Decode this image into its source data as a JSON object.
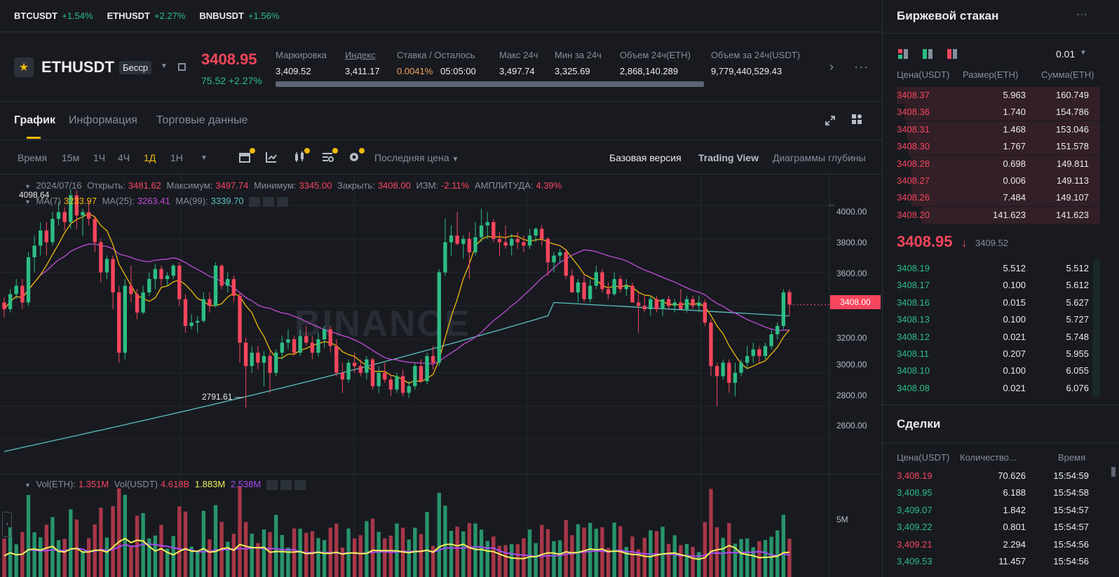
{
  "ticker": [
    {
      "symbol": "BTCUSDT",
      "change": "+1.54%"
    },
    {
      "symbol": "ETHUSDT",
      "change": "+2.27%"
    },
    {
      "symbol": "BNBUSDT",
      "change": "+1.56%"
    }
  ],
  "header": {
    "symbol": "ETHUSDT",
    "contract": "Бесср",
    "last_price": "3408.95",
    "change": "75.52 +2.27%",
    "stats": [
      {
        "label": "Маркировка",
        "value": "3,409.52"
      },
      {
        "label": "Индекс",
        "value": "3,411.17"
      },
      {
        "label": "Ставка / Осталось",
        "value": "0.0041%",
        "value2": "05:05:00"
      },
      {
        "label": "Макс 24ч",
        "value": "3,497.74"
      },
      {
        "label": "Мин за 24ч",
        "value": "3,325.69"
      },
      {
        "label": "Объем 24ч(ETH)",
        "value": "2,868,140.289"
      },
      {
        "label": "Объем за 24ч(USDT)",
        "value": "9,779,440,529.43"
      }
    ]
  },
  "tabs": [
    "График",
    "Информация",
    "Торговые данные"
  ],
  "toolbar": {
    "time_label": "Время",
    "intervals": [
      "15м",
      "1Ч",
      "4Ч",
      "1Д",
      "1Н"
    ],
    "selected_interval": "1Д",
    "price_type": "Последняя цена",
    "views": [
      "Базовая версия",
      "Trading View",
      "Диаграммы глубины"
    ]
  },
  "chart_legend": {
    "date": "2024/07/16",
    "open_label": "Открыть:",
    "open": "3481.62",
    "high_label": "Максимум:",
    "high": "3497.74",
    "low_label": "Минимум:",
    "low": "3345.00",
    "close_label": "Закрыть:",
    "close": "3408.00",
    "chg_label": "ИЗМ:",
    "chg": "-2.11%",
    "amp_label": "АМПЛИТУДА:",
    "amp": "4.39%",
    "ma7_label": "MA(7)",
    "ma7": "3233.97",
    "ma25_label": "MA(25):",
    "ma25": "3263.41",
    "ma99_label": "MA(99):",
    "ma99": "3339.70",
    "vol_eth_label": "Vol(ETH):",
    "vol_eth": "1.351M",
    "vol_usdt_label": "Vol(USDT)",
    "vol_usdt": "4.618B",
    "vol_ma1": "1.883M",
    "vol_ma2": "2.538M"
  },
  "chart_labels": {
    "max_marker": "4098.64",
    "min_marker": "2791.61 —",
    "price_tag": "3408.00",
    "watermark": "BINANCE",
    "yticks": [
      "4000.00",
      "3800.00",
      "3600.00",
      "3400.00",
      "3200.00",
      "3000.00",
      "2800.00",
      "2600.00"
    ],
    "vol_tick": "5M"
  },
  "chart_data": {
    "type": "candlestick",
    "ylim": [
      2400,
      4180
    ],
    "candles": [
      [
        3420,
        3450,
        3330,
        3380
      ],
      [
        3380,
        3500,
        3360,
        3470
      ],
      [
        3470,
        3560,
        3440,
        3520
      ],
      [
        3520,
        3560,
        3380,
        3420
      ],
      [
        3420,
        3720,
        3400,
        3690
      ],
      [
        3690,
        3820,
        3600,
        3760
      ],
      [
        3760,
        3900,
        3700,
        3850
      ],
      [
        3850,
        3900,
        3700,
        3780
      ],
      [
        3780,
        3960,
        3760,
        3920
      ],
      [
        3920,
        4020,
        3880,
        3960
      ],
      [
        3960,
        3990,
        3850,
        3900
      ],
      [
        3900,
        4098,
        3860,
        4060
      ],
      [
        4060,
        4090,
        3860,
        3940
      ],
      [
        3940,
        3980,
        3820,
        3960
      ],
      [
        3960,
        4030,
        3880,
        3920
      ],
      [
        3920,
        3930,
        3720,
        3780
      ],
      [
        3780,
        3800,
        3540,
        3600
      ],
      [
        3600,
        3700,
        3560,
        3680
      ],
      [
        3680,
        3700,
        3380,
        3480
      ],
      [
        3480,
        3520,
        3060,
        3120
      ],
      [
        3120,
        3560,
        3080,
        3520
      ],
      [
        3520,
        3640,
        3420,
        3470
      ],
      [
        3470,
        3500,
        3320,
        3360
      ],
      [
        3360,
        3520,
        3350,
        3480
      ],
      [
        3480,
        3600,
        3460,
        3560
      ],
      [
        3560,
        3650,
        3500,
        3620
      ],
      [
        3620,
        3640,
        3520,
        3560
      ],
      [
        3560,
        3600,
        3520,
        3580
      ],
      [
        3580,
        3650,
        3560,
        3640
      ],
      [
        3640,
        3660,
        3400,
        3440
      ],
      [
        3440,
        3470,
        3240,
        3280
      ],
      [
        3280,
        3350,
        3260,
        3300
      ],
      [
        3300,
        3340,
        3240,
        3310
      ],
      [
        3310,
        3480,
        3300,
        3440
      ],
      [
        3440,
        3480,
        3360,
        3400
      ],
      [
        3400,
        3660,
        3390,
        3640
      ],
      [
        3640,
        3650,
        3500,
        3520
      ],
      [
        3520,
        3600,
        3480,
        3560
      ],
      [
        3560,
        3580,
        3420,
        3460
      ],
      [
        3460,
        3480,
        3060,
        3180
      ],
      [
        3180,
        3210,
        2791,
        3040
      ],
      [
        3040,
        3160,
        3000,
        3120
      ],
      [
        3120,
        3160,
        3020,
        3060
      ],
      [
        3060,
        3130,
        2920,
        3100
      ],
      [
        3100,
        3130,
        2880,
        3000
      ],
      [
        3000,
        3140,
        2980,
        3120
      ],
      [
        3120,
        3220,
        3080,
        3180
      ],
      [
        3180,
        3260,
        3140,
        3200
      ],
      [
        3200,
        3220,
        3100,
        3120
      ],
      [
        3120,
        3260,
        3100,
        3220
      ],
      [
        3220,
        3280,
        3160,
        3180
      ],
      [
        3180,
        3220,
        3080,
        3120
      ],
      [
        3120,
        3240,
        3100,
        3200
      ],
      [
        3200,
        3280,
        3150,
        3260
      ],
      [
        3260,
        3280,
        3120,
        3160
      ],
      [
        3160,
        3200,
        2980,
        3000
      ],
      [
        3000,
        3060,
        2880,
        2960
      ],
      [
        2960,
        3080,
        2940,
        3060
      ],
      [
        3060,
        3120,
        3000,
        3040
      ],
      [
        3040,
        3080,
        2980,
        3000
      ],
      [
        3000,
        3100,
        2960,
        3080
      ],
      [
        3080,
        3090,
        2900,
        2920
      ],
      [
        2920,
        3040,
        2880,
        3000
      ],
      [
        3000,
        3060,
        2940,
        2960
      ],
      [
        2960,
        2990,
        2860,
        2900
      ],
      [
        2900,
        3000,
        2880,
        2980
      ],
      [
        2980,
        3020,
        2860,
        2880
      ],
      [
        2880,
        2950,
        2850,
        2920
      ],
      [
        2920,
        3060,
        2900,
        3040
      ],
      [
        3040,
        3080,
        2940,
        2950
      ],
      [
        2950,
        3120,
        2930,
        3100
      ],
      [
        3100,
        3160,
        3020,
        3060
      ],
      [
        3060,
        3620,
        3040,
        3600
      ],
      [
        3600,
        3920,
        3580,
        3780
      ],
      [
        3780,
        3880,
        3700,
        3820
      ],
      [
        3820,
        3960,
        3760,
        3770
      ],
      [
        3770,
        3820,
        3680,
        3800
      ],
      [
        3800,
        3840,
        3560,
        3720
      ],
      [
        3720,
        3900,
        3700,
        3810
      ],
      [
        3810,
        3980,
        3780,
        3880
      ],
      [
        3880,
        3960,
        3800,
        3900
      ],
      [
        3900,
        3920,
        3780,
        3800
      ],
      [
        3800,
        3840,
        3700,
        3780
      ],
      [
        3780,
        3880,
        3740,
        3760
      ],
      [
        3760,
        3830,
        3700,
        3800
      ],
      [
        3800,
        3840,
        3740,
        3780
      ],
      [
        3780,
        3820,
        3720,
        3760
      ],
      [
        3760,
        3860,
        3740,
        3820
      ],
      [
        3820,
        3870,
        3780,
        3860
      ],
      [
        3860,
        3880,
        3760,
        3800
      ],
      [
        3800,
        3810,
        3580,
        3660
      ],
      [
        3660,
        3720,
        3600,
        3700
      ],
      [
        3700,
        3740,
        3660,
        3720
      ],
      [
        3720,
        3740,
        3560,
        3580
      ],
      [
        3580,
        3620,
        3480,
        3480
      ],
      [
        3480,
        3560,
        3420,
        3540
      ],
      [
        3540,
        3580,
        3420,
        3440
      ],
      [
        3440,
        3560,
        3420,
        3520
      ],
      [
        3520,
        3640,
        3500,
        3600
      ],
      [
        3600,
        3620,
        3480,
        3500
      ],
      [
        3500,
        3540,
        3440,
        3470
      ],
      [
        3470,
        3600,
        3460,
        3560
      ],
      [
        3560,
        3580,
        3480,
        3500
      ],
      [
        3500,
        3560,
        3460,
        3520
      ],
      [
        3520,
        3540,
        3420,
        3420
      ],
      [
        3420,
        3480,
        3240,
        3400
      ],
      [
        3400,
        3460,
        3360,
        3380
      ],
      [
        3380,
        3460,
        3340,
        3440
      ],
      [
        3440,
        3460,
        3360,
        3380
      ],
      [
        3380,
        3420,
        3340,
        3440
      ],
      [
        3440,
        3460,
        3380,
        3400
      ],
      [
        3400,
        3440,
        3360,
        3420
      ],
      [
        3420,
        3500,
        3400,
        3380
      ],
      [
        3380,
        3460,
        3360,
        3440
      ],
      [
        3440,
        3460,
        3380,
        3400
      ],
      [
        3400,
        3460,
        3360,
        3420
      ],
      [
        3420,
        3440,
        3280,
        3300
      ],
      [
        3300,
        3320,
        2980,
        3040
      ],
      [
        3040,
        3060,
        2800,
        2980
      ],
      [
        2980,
        3080,
        2960,
        3060
      ],
      [
        3060,
        3080,
        2880,
        2940
      ],
      [
        2940,
        3060,
        2860,
        3000
      ],
      [
        3000,
        3080,
        2980,
        3060
      ],
      [
        3060,
        3160,
        3020,
        3100
      ],
      [
        3100,
        3180,
        3060,
        3140
      ],
      [
        3140,
        3160,
        3060,
        3100
      ],
      [
        3100,
        3180,
        3080,
        3160
      ],
      [
        3160,
        3260,
        3140,
        3230
      ],
      [
        3230,
        3300,
        3200,
        3280
      ],
      [
        3280,
        3500,
        3260,
        3480
      ],
      [
        3481.62,
        3497.74,
        3345.0,
        3408.0
      ]
    ]
  },
  "orderbook": {
    "title": "Биржевой стакан",
    "precision": "0.01",
    "headers": [
      "Цена(USDT)",
      "Размер(ETH)",
      "Сумма(ETH)"
    ],
    "asks": [
      [
        "3408.37",
        "5.963",
        "160.749"
      ],
      [
        "3408.36",
        "1.740",
        "154.786"
      ],
      [
        "3408.31",
        "1.468",
        "153.046"
      ],
      [
        "3408.30",
        "1.767",
        "151.578"
      ],
      [
        "3408.28",
        "0.698",
        "149.811"
      ],
      [
        "3408.27",
        "0.006",
        "149.113"
      ],
      [
        "3408.26",
        "7.484",
        "149.107"
      ],
      [
        "3408.20",
        "141.623",
        "141.623"
      ]
    ],
    "mid_price": "3408.95",
    "mid_mark": "3409.52",
    "bids": [
      [
        "3408.19",
        "5.512",
        "5.512"
      ],
      [
        "3408.17",
        "0.100",
        "5.612"
      ],
      [
        "3408.16",
        "0.015",
        "5.627"
      ],
      [
        "3408.13",
        "0.100",
        "5.727"
      ],
      [
        "3408.12",
        "0.021",
        "5.748"
      ],
      [
        "3408.11",
        "0.207",
        "5.955"
      ],
      [
        "3408.10",
        "0.100",
        "6.055"
      ],
      [
        "3408.08",
        "0.021",
        "6.076"
      ]
    ]
  },
  "trades": {
    "title": "Сделки",
    "headers": [
      "Цена(USDT)",
      "Количество...",
      "Время"
    ],
    "rows": [
      [
        "3,408.19",
        "70.626",
        "15:54:59",
        "red"
      ],
      [
        "3,408.95",
        "6.188",
        "15:54:58",
        "green"
      ],
      [
        "3,409.07",
        "1.842",
        "15:54:57",
        "green"
      ],
      [
        "3,409.22",
        "0.801",
        "15:54:57",
        "green"
      ],
      [
        "3,409.21",
        "2.294",
        "15:54:56",
        "red"
      ],
      [
        "3,409.53",
        "11.457",
        "15:54:56",
        "green"
      ]
    ]
  },
  "colors": {
    "up": "#2ebd85",
    "down": "#f6465d",
    "accent": "#f0b90b",
    "ma7": "#f0b90b",
    "ma25": "#c24cd6",
    "ma99": "#5bc0c0"
  }
}
